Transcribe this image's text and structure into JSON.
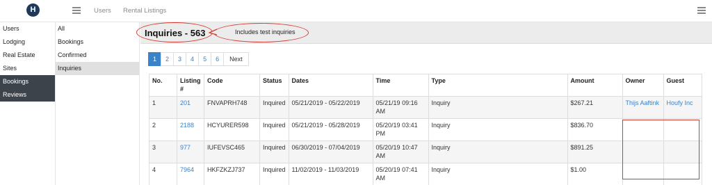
{
  "header": {
    "nav_users": "Users",
    "nav_rentals": "Rental Listings",
    "logo_letter": "H"
  },
  "sidebar_primary": [
    "Users",
    "Lodging",
    "Real Estate",
    "Sites",
    "Bookings",
    "Reviews"
  ],
  "sidebar_secondary": [
    "All",
    "Bookings",
    "Confirmed",
    "Inquiries"
  ],
  "main": {
    "title": "Inquiries - 563",
    "callout": "Includes test inquiries",
    "pages": [
      "1",
      "2",
      "3",
      "4",
      "5",
      "6"
    ],
    "next_label": "Next",
    "active_page": "1"
  },
  "table": {
    "headers": [
      "No.",
      "Listing #",
      "Code",
      "Status",
      "Dates",
      "Time",
      "Type",
      "Amount",
      "Owner",
      "Guest"
    ],
    "rows": [
      [
        "1",
        "201",
        "FNVAPRH748",
        "Inquired",
        "05/21/2019 - 05/22/2019",
        "05/21/19 09:16 AM",
        "Inquiry",
        "$267.21",
        "Thijs Aaftink",
        "Houfy Inc"
      ],
      [
        "2",
        "2188",
        "HCYURER598",
        "Inquired",
        "05/21/2019 - 05/28/2019",
        "05/20/19 03:41 PM",
        "Inquiry",
        "$836.70",
        "",
        ""
      ],
      [
        "3",
        "977",
        "IUFEVSC465",
        "Inquired",
        "06/30/2019 - 07/04/2019",
        "05/20/19 10:47 AM",
        "Inquiry",
        "$891.25",
        "",
        ""
      ],
      [
        "4",
        "7964",
        "HKFZKZJ737",
        "Inquired",
        "11/02/2019 - 11/03/2019",
        "05/20/19 07:41 AM",
        "Inquiry",
        "$1.00",
        "",
        ""
      ]
    ]
  },
  "colors": {
    "accent": "#3a83c9",
    "annotation": "#d43a2f",
    "dark_sidebar": "#3d434a"
  }
}
